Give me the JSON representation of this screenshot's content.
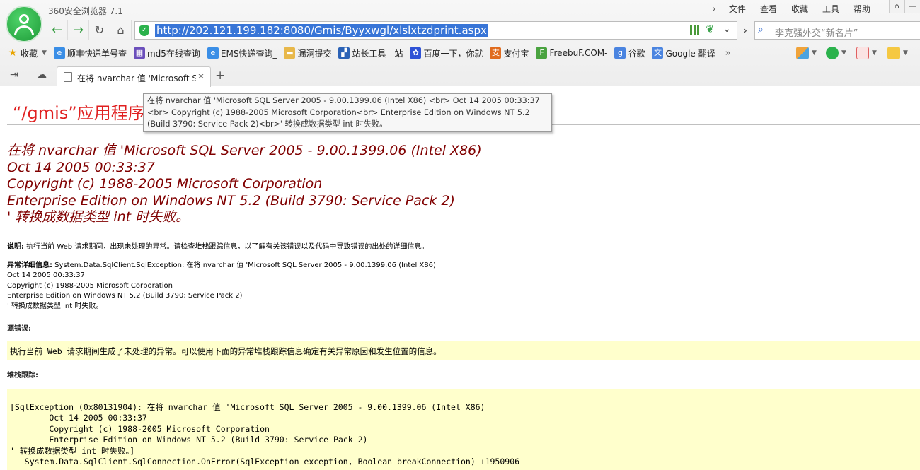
{
  "window": {
    "title": "360安全浏览器 7.1"
  },
  "menu": {
    "items": [
      "文件",
      "查看",
      "收藏",
      "工具",
      "帮助"
    ]
  },
  "address": {
    "url": "http://202.121.199.182:8080/Gmis/Byyxwgl/xlslxtzdprint.aspx"
  },
  "search": {
    "placeholder": "李克强外交“新名片”"
  },
  "favorites": {
    "main_label": "收藏",
    "items": [
      {
        "label": "顺丰快递单号查",
        "color": "#3a8ee6"
      },
      {
        "label": "md5在线查询",
        "color": "#6b4fbb"
      },
      {
        "label": "EMS快递查询_",
        "color": "#3a8ee6"
      },
      {
        "label": "漏洞提交",
        "color": "#e8b84a"
      },
      {
        "label": "站长工具 - 站",
        "color": "#2b62b6"
      },
      {
        "label": "百度一下，你就",
        "color": "#2f52d6"
      },
      {
        "label": "支付宝",
        "color": "#e06b1e"
      },
      {
        "label": "FreebuF.COM-",
        "color": "#4aa340"
      },
      {
        "label": "谷歌",
        "color": "#4a84e0"
      },
      {
        "label": "Google 翻译",
        "color": "#4a84e0"
      }
    ]
  },
  "tab": {
    "title": "在将 nvarchar 值 'Microsoft S"
  },
  "page": {
    "app_title": "“/gmis”应用程序",
    "error_lines": [
      "在将 nvarchar 值 'Microsoft SQL Server 2005 - 9.00.1399.06 (Intel X86)",
      "Oct 14 2005 00:33:37",
      "Copyright (c) 1988-2005 Microsoft Corporation",
      "Enterprise Edition on Windows NT 5.2 (Build 3790: Service Pack 2)",
      "' 转换成数据类型 int 时失败。"
    ],
    "desc_label": "说明:",
    "desc_text": " 执行当前 Web 请求期间，出现未处理的异常。请检查堆栈跟踪信息，以了解有关该错误以及代码中导致错误的出处的详细信息。",
    "detail_label": "异常详细信息:",
    "detail_lines": [
      " System.Data.SqlClient.SqlException: 在将  nvarchar 值  'Microsoft SQL Server 2005 - 9.00.1399.06 (Intel X86)",
      "Oct 14 2005 00:33:37",
      "Copyright (c) 1988-2005 Microsoft Corporation",
      "Enterprise Edition on Windows NT 5.2 (Build 3790: Service Pack 2)",
      "' 转换成数据类型  int 时失败。"
    ],
    "source_label": "源错误:",
    "source_text": "执行当前 Web 请求期间生成了未处理的异常。可以使用下面的异常堆栈跟踪信息确定有关异常原因和发生位置的信息。",
    "stack_label": "堆栈跟踪:",
    "stack_lines": [
      "[SqlException (0x80131904): 在将 nvarchar 值 'Microsoft SQL Server 2005 - 9.00.1399.06 (Intel X86)",
      "        Oct 14 2005 00:33:37",
      "        Copyright (c) 1988-2005 Microsoft Corporation",
      "        Enterprise Edition on Windows NT 5.2 (Build 3790: Service Pack 2)",
      "' 转换成数据类型 int 时失败。]",
      "   System.Data.SqlClient.SqlConnection.OnError(SqlException exception, Boolean breakConnection) +1950906"
    ]
  },
  "tooltip": {
    "lines": [
      "在将 nvarchar 值 'Microsoft SQL Server 2005 - 9.00.1399.06 (Intel X86) <br> Oct 14 2005 00:33:37",
      "<br> Copyright (c) 1988-2005 Microsoft Corporation<br> Enterprise Edition on Windows NT 5.2",
      "(Build 3790: Service Pack 2)<br>' 转换成数据类型 int 时失败。"
    ]
  },
  "colors": {
    "brand_green": "#2bb24c",
    "error_red": "#e02020",
    "error_dark": "#800000",
    "highlight": "#ffffcc",
    "url_select": "#3875d7"
  }
}
